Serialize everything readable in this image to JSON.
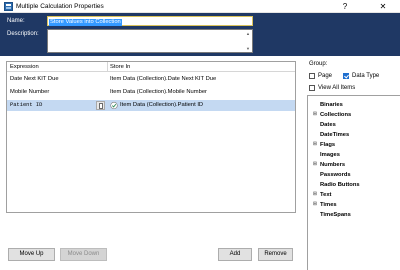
{
  "window": {
    "title": "Multiple Calculation Properties",
    "help_glyph": "?",
    "close_glyph": "✕"
  },
  "form": {
    "name_label": "Name:",
    "name_value": "Store Values into Collection",
    "description_label": "Description:",
    "description_value": ""
  },
  "grid": {
    "columns": [
      "Expression",
      "Store In"
    ],
    "rows": [
      {
        "expression": "Date Next KIT Due",
        "store_in": "Item Data (Collection).Date Next KIT Due",
        "selected": false
      },
      {
        "expression": "Mobile Number",
        "store_in": "Item Data (Collection).Mobile Number",
        "selected": false
      },
      {
        "expression": "Patient ID",
        "store_in": "Item Data (Collection).Patient ID",
        "selected": true
      }
    ]
  },
  "buttons": {
    "move_up": "Move Up",
    "move_down": "Move Down",
    "add": "Add",
    "remove": "Remove"
  },
  "group": {
    "label": "Group:",
    "page": {
      "label": "Page",
      "checked": false
    },
    "data_type": {
      "label": "Data Type",
      "checked": true
    },
    "view_all": {
      "label": "View All Items",
      "checked": false
    }
  },
  "tree": {
    "items": [
      {
        "label": "Binaries",
        "expandable": false
      },
      {
        "label": "Collections",
        "expandable": true
      },
      {
        "label": "Dates",
        "expandable": false
      },
      {
        "label": "DateTimes",
        "expandable": false
      },
      {
        "label": "Flags",
        "expandable": true
      },
      {
        "label": "Images",
        "expandable": false
      },
      {
        "label": "Numbers",
        "expandable": true
      },
      {
        "label": "Passwords",
        "expandable": false
      },
      {
        "label": "Radio Buttons",
        "expandable": false
      },
      {
        "label": "Text",
        "expandable": true
      },
      {
        "label": "Times",
        "expandable": true
      },
      {
        "label": "TimeSpans",
        "expandable": false
      }
    ]
  },
  "colors": {
    "panel": "#1f3864",
    "selection": "#3399ff",
    "row_selected": "#c4d9f2",
    "checkbox_accent": "#1f6fcf"
  }
}
